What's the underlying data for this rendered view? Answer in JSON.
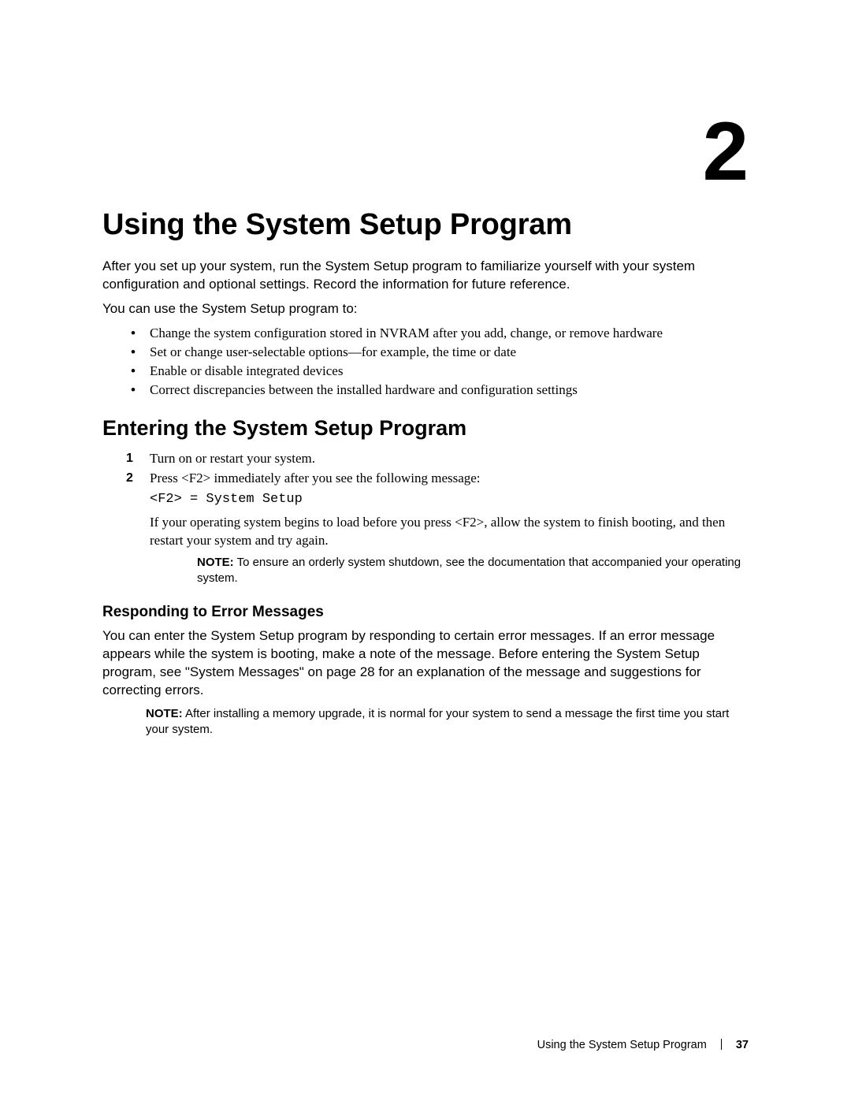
{
  "chapter": {
    "number": "2",
    "title": "Using the System Setup Program",
    "intro1": "After you set up your system, run the System Setup program to familiarize yourself with your system configuration and optional settings. Record the information for future reference.",
    "intro2": "You can use the System Setup program to:",
    "bullets": [
      "Change the system configuration stored in NVRAM after you add, change, or remove hardware",
      "Set or change user-selectable options—for example, the time or date",
      "Enable or disable integrated devices",
      "Correct discrepancies between the installed hardware and configuration settings"
    ]
  },
  "section1": {
    "title": "Entering the System Setup Program",
    "step1": "Turn on or restart your system.",
    "step2_lead": "Press <F2> immediately after you see the following message:",
    "step2_code": "<F2> = System Setup",
    "step2_body": "If your operating system begins to load before you press <F2>, allow the system to finish booting, and then restart your system and try again.",
    "note_label": "NOTE:",
    "note_text": " To ensure an orderly system shutdown, see the documentation that accompanied your operating system."
  },
  "subsection1": {
    "title": "Responding to Error Messages",
    "body": "You can enter the System Setup program by responding to certain error messages. If an error message appears while the system is booting, make a note of the message. Before entering the System Setup program, see \"System Messages\" on page 28 for an explanation of the message and suggestions for correcting errors.",
    "note_label": "NOTE:",
    "note_text": " After installing a memory upgrade, it is normal for your system to send a message the first time you start your system."
  },
  "footer": {
    "running_head": "Using the System Setup Program",
    "page_number": "37"
  }
}
